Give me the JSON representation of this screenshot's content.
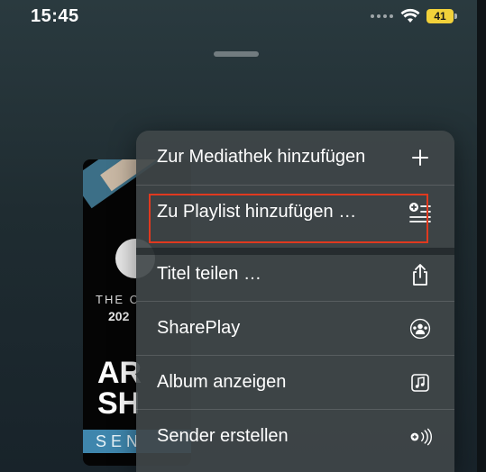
{
  "status_bar": {
    "time": "15:45",
    "battery_level": "41",
    "battery_color": "#f2d13a"
  },
  "album_art": {
    "line1": "THE C",
    "line2": "202",
    "big1": "AR",
    "big2": "SH",
    "bar_text": "SEN"
  },
  "menu": {
    "items": [
      {
        "label": "Zur Mediathek hinzufügen",
        "icon": "plus-icon"
      },
      {
        "label": "Zu Playlist hinzufügen …",
        "icon": "add-to-playlist-icon"
      },
      {
        "label": "Titel teilen …",
        "icon": "share-icon"
      },
      {
        "label": "SharePlay",
        "icon": "shareplay-icon"
      },
      {
        "label": "Album anzeigen",
        "icon": "album-icon"
      },
      {
        "label": "Sender erstellen",
        "icon": "station-icon"
      }
    ]
  },
  "highlight_color": "#e0391f"
}
